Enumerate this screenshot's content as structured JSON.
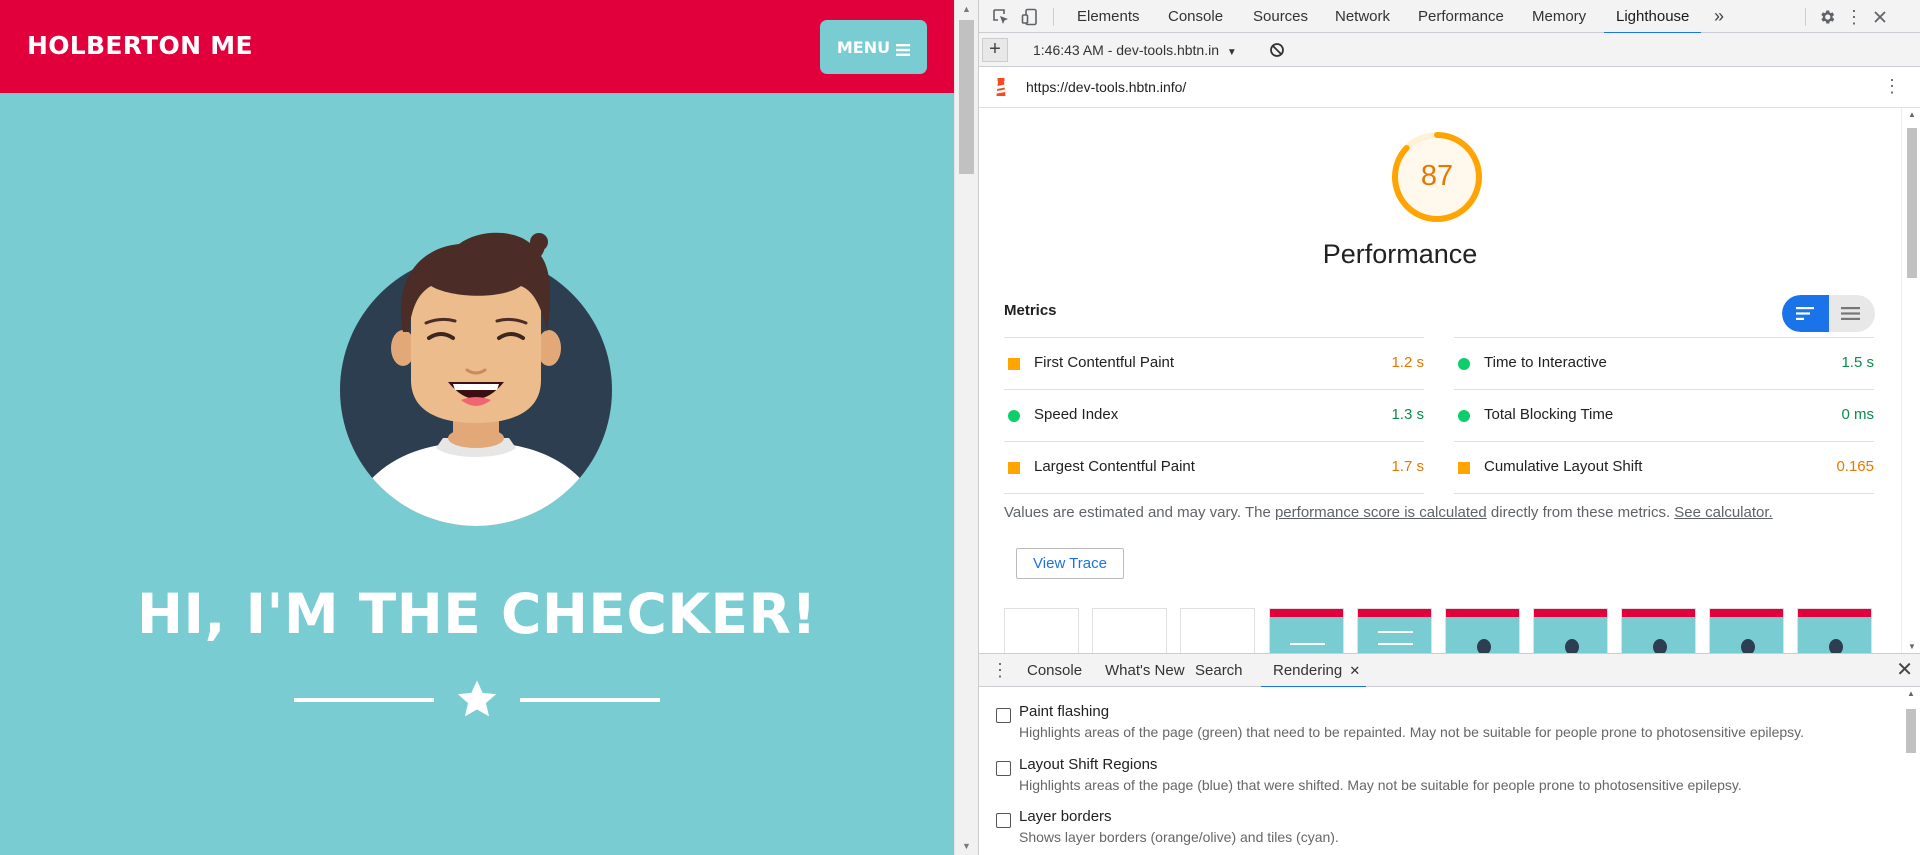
{
  "site": {
    "brand": "HOLBERTON ME",
    "menu_label": "MENU",
    "menu_icon": "hamburger-icon",
    "hero_title": "HI, I'M THE CHECKER!",
    "divider_icon": "star-icon",
    "colors": {
      "nav": "#e2003c",
      "bg": "#78ccd2",
      "avatar_bg": "#2d3e50"
    }
  },
  "devtools": {
    "tabs": [
      "Elements",
      "Console",
      "Sources",
      "Network",
      "Performance",
      "Memory",
      "Lighthouse"
    ],
    "active_tab": "Lighthouse",
    "more_tabs_icon": "chevron-double-right-icon",
    "session_label": "1:46:43 AM - dev-tools.hbtn.in",
    "report_url": "https://dev-tools.hbtn.info/",
    "report": {
      "score": "87",
      "category": "Performance",
      "metrics_title": "Metrics",
      "metrics_left": [
        {
          "name": "First Contentful Paint",
          "value": "1.2 s",
          "status": "average"
        },
        {
          "name": "Speed Index",
          "value": "1.3 s",
          "status": "pass"
        },
        {
          "name": "Largest Contentful Paint",
          "value": "1.7 s",
          "status": "average"
        }
      ],
      "metrics_right": [
        {
          "name": "Time to Interactive",
          "value": "1.5 s",
          "status": "pass"
        },
        {
          "name": "Total Blocking Time",
          "value": "0 ms",
          "status": "pass"
        },
        {
          "name": "Cumulative Layout Shift",
          "value": "0.165",
          "status": "average"
        }
      ],
      "note_prefix": "Values are estimated and may vary. The ",
      "note_link1": "performance score is calculated",
      "note_middle": " directly from these metrics. ",
      "note_link2": "See calculator.",
      "view_trace": "View Trace",
      "colors": {
        "average": "#ffa400",
        "pass": "#0cce6b",
        "gauge": "#ffa400"
      }
    },
    "drawer": {
      "tabs": [
        "Console",
        "What's New",
        "Search",
        "Rendering"
      ],
      "active_tab": "Rendering",
      "options": [
        {
          "title": "Paint flashing",
          "desc": "Highlights areas of the page (green) that need to be repainted. May not be suitable for people prone to photosensitive epilepsy.",
          "checked": false
        },
        {
          "title": "Layout Shift Regions",
          "desc": "Highlights areas of the page (blue) that were shifted. May not be suitable for people prone to photosensitive epilepsy.",
          "checked": false
        },
        {
          "title": "Layer borders",
          "desc": "Shows layer borders (orange/olive) and tiles (cyan).",
          "checked": false
        }
      ]
    }
  }
}
